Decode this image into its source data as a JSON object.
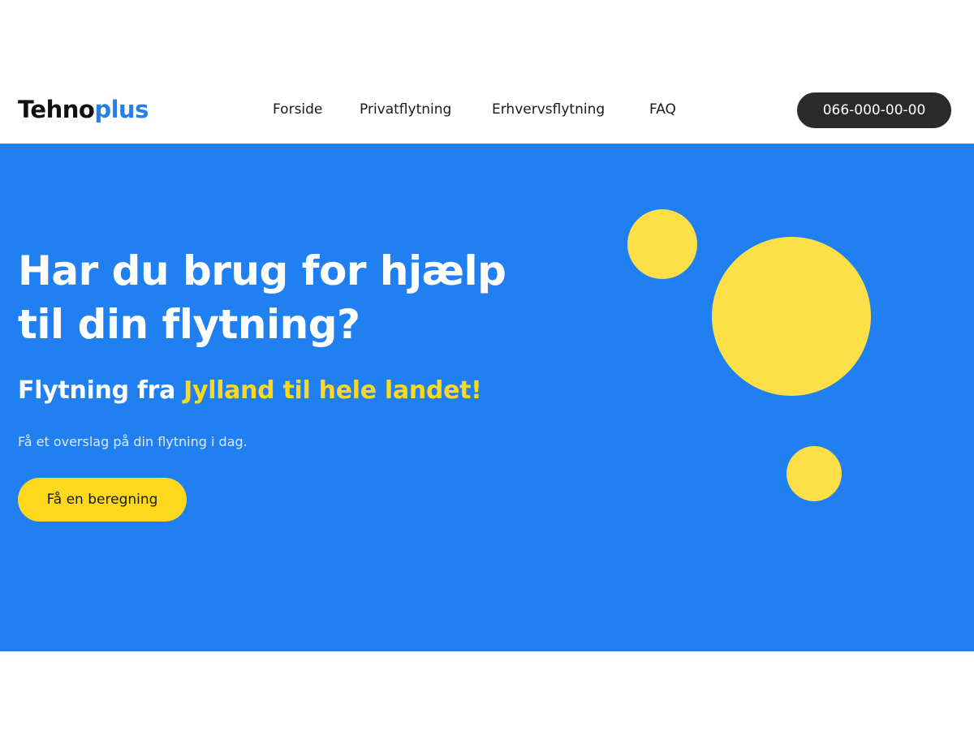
{
  "header": {
    "logo": {
      "main": "Tehno",
      "accent": "plus"
    },
    "nav": [
      {
        "label": "Forside"
      },
      {
        "label": "Privatflytning"
      },
      {
        "label": "Erhvervsflytning"
      },
      {
        "label": "FAQ"
      }
    ],
    "phone_label": "066-000-00-00"
  },
  "hero": {
    "title_line1": "Har du brug for hjælp",
    "title_line2": "til din flytning?",
    "subtitle_prefix": "Flytning fra",
    "subtitle_highlight": "Jylland til hele landet!",
    "tagline": "Få et overslag på din flytning i dag.",
    "cta_label": "Få en beregning"
  },
  "colors": {
    "brand_blue": "#2180f1",
    "accent_yellow": "#fdd81c",
    "circle_yellow": "#fde047",
    "phone_button_bg": "#2a2a2a"
  }
}
